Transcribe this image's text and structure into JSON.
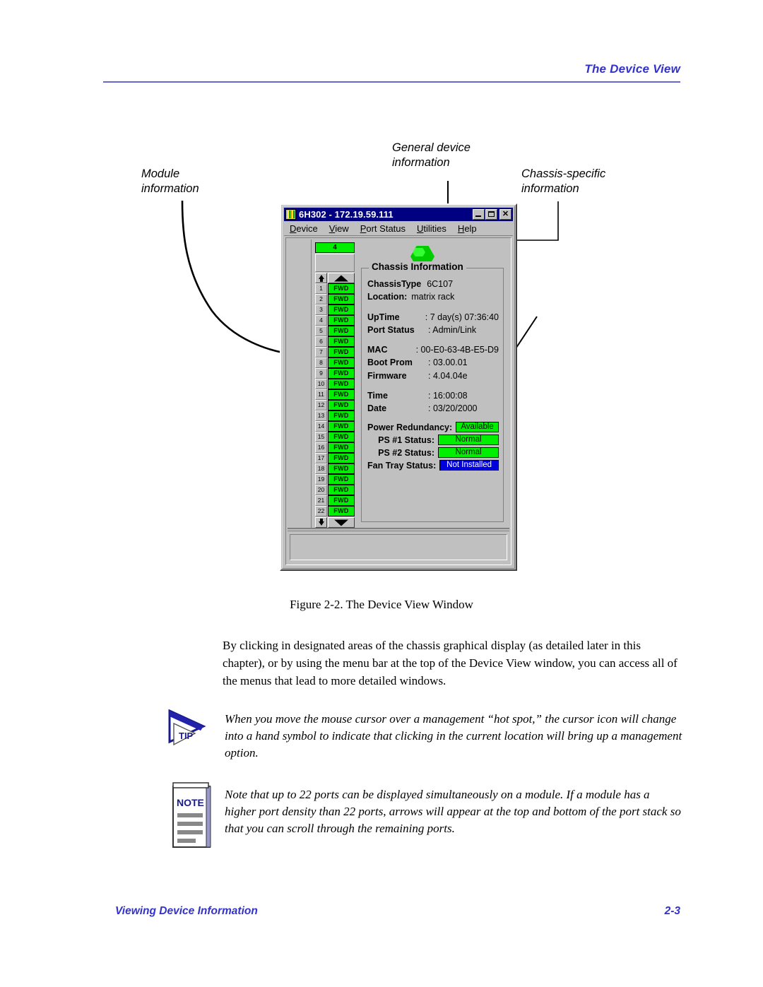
{
  "header": {
    "title": "The Device View"
  },
  "footer": {
    "left": "Viewing Device Information",
    "page": "2-3"
  },
  "callouts": {
    "module": "Module\ninformation",
    "module_line1": "Module",
    "module_line2": "information",
    "general_line1": "General device",
    "general_line2": "information",
    "chassis_line1": "Chassis-specific",
    "chassis_line2": "information"
  },
  "window": {
    "title": "6H302 - 172.19.59.111",
    "icon": "module-icon",
    "buttons": {
      "minimize": "minimize-button",
      "maximize": "maximize-button",
      "close": "close-button",
      "close_glyph": "✕"
    },
    "menus": [
      {
        "mnemonic": "D",
        "rest": "evice"
      },
      {
        "mnemonic": "V",
        "rest": "iew"
      },
      {
        "mnemonic": "P",
        "rest": "ort Status"
      },
      {
        "mnemonic": "U",
        "rest": "tilities"
      },
      {
        "mnemonic": "H",
        "rest": "elp"
      }
    ],
    "module": {
      "slot_number": "4",
      "port_state_label": "FWD",
      "ports": [
        "1",
        "2",
        "3",
        "4",
        "5",
        "6",
        "7",
        "8",
        "9",
        "10",
        "11",
        "12",
        "13",
        "14",
        "15",
        "16",
        "17",
        "18",
        "19",
        "20",
        "21",
        "22"
      ]
    },
    "chassis_info": {
      "group_title": "Chassis Information",
      "rows_top": [
        {
          "label": "ChassisType",
          "value": "6C107"
        },
        {
          "label": "Location:",
          "value": "matrix rack"
        }
      ],
      "rows_mid": [
        {
          "label": "UpTime",
          "value": ": 7 day(s) 07:36:40"
        },
        {
          "label": "Port Status",
          "value": ": Admin/Link"
        }
      ],
      "rows_mac": [
        {
          "label": "MAC",
          "value": ": 00-E0-63-4B-E5-D9"
        },
        {
          "label": "Boot Prom",
          "value": ": 03.00.01"
        },
        {
          "label": "Firmware",
          "value": ": 4.04.04e"
        }
      ],
      "rows_time": [
        {
          "label": "Time",
          "value": ": 16:00:08"
        },
        {
          "label": "Date",
          "value": ": 03/20/2000"
        }
      ],
      "status_rows": [
        {
          "label": "Power Redundancy:",
          "value": "Available",
          "style": "green"
        },
        {
          "label": "PS #1 Status:",
          "value": "Normal",
          "style": "green"
        },
        {
          "label": "PS #2 Status:",
          "value": "Normal",
          "style": "green"
        },
        {
          "label": "Fan Tray Status:",
          "value": "Not Installed",
          "style": "blue"
        }
      ]
    }
  },
  "figure": {
    "caption": "Figure 2-2.  The Device View Window"
  },
  "paragraph": "By clicking in designated areas of the chassis graphical display (as detailed later in this chapter), or by using the menu bar at the top of the Device View window, you can access all of the menus that lead to more detailed windows.",
  "tip": {
    "label": "TIP",
    "text": "When you move the mouse cursor over a management “hot spot,” the cursor icon will change into a hand symbol to indicate that clicking in the current location will bring up a management option."
  },
  "note": {
    "label": "NOTE",
    "text": "Note that up to 22 ports can be displayed simultaneously on a module. If a module has a higher port density than 22 ports, arrows will appear at the top and bottom of the port stack so that you can scroll through the remaining ports."
  },
  "colors": {
    "accent_blue": "#3333cc",
    "titlebar": "#000080",
    "port_green": "#00ee00",
    "status_blue": "#0000dd",
    "window_face": "#c0c0c0"
  }
}
